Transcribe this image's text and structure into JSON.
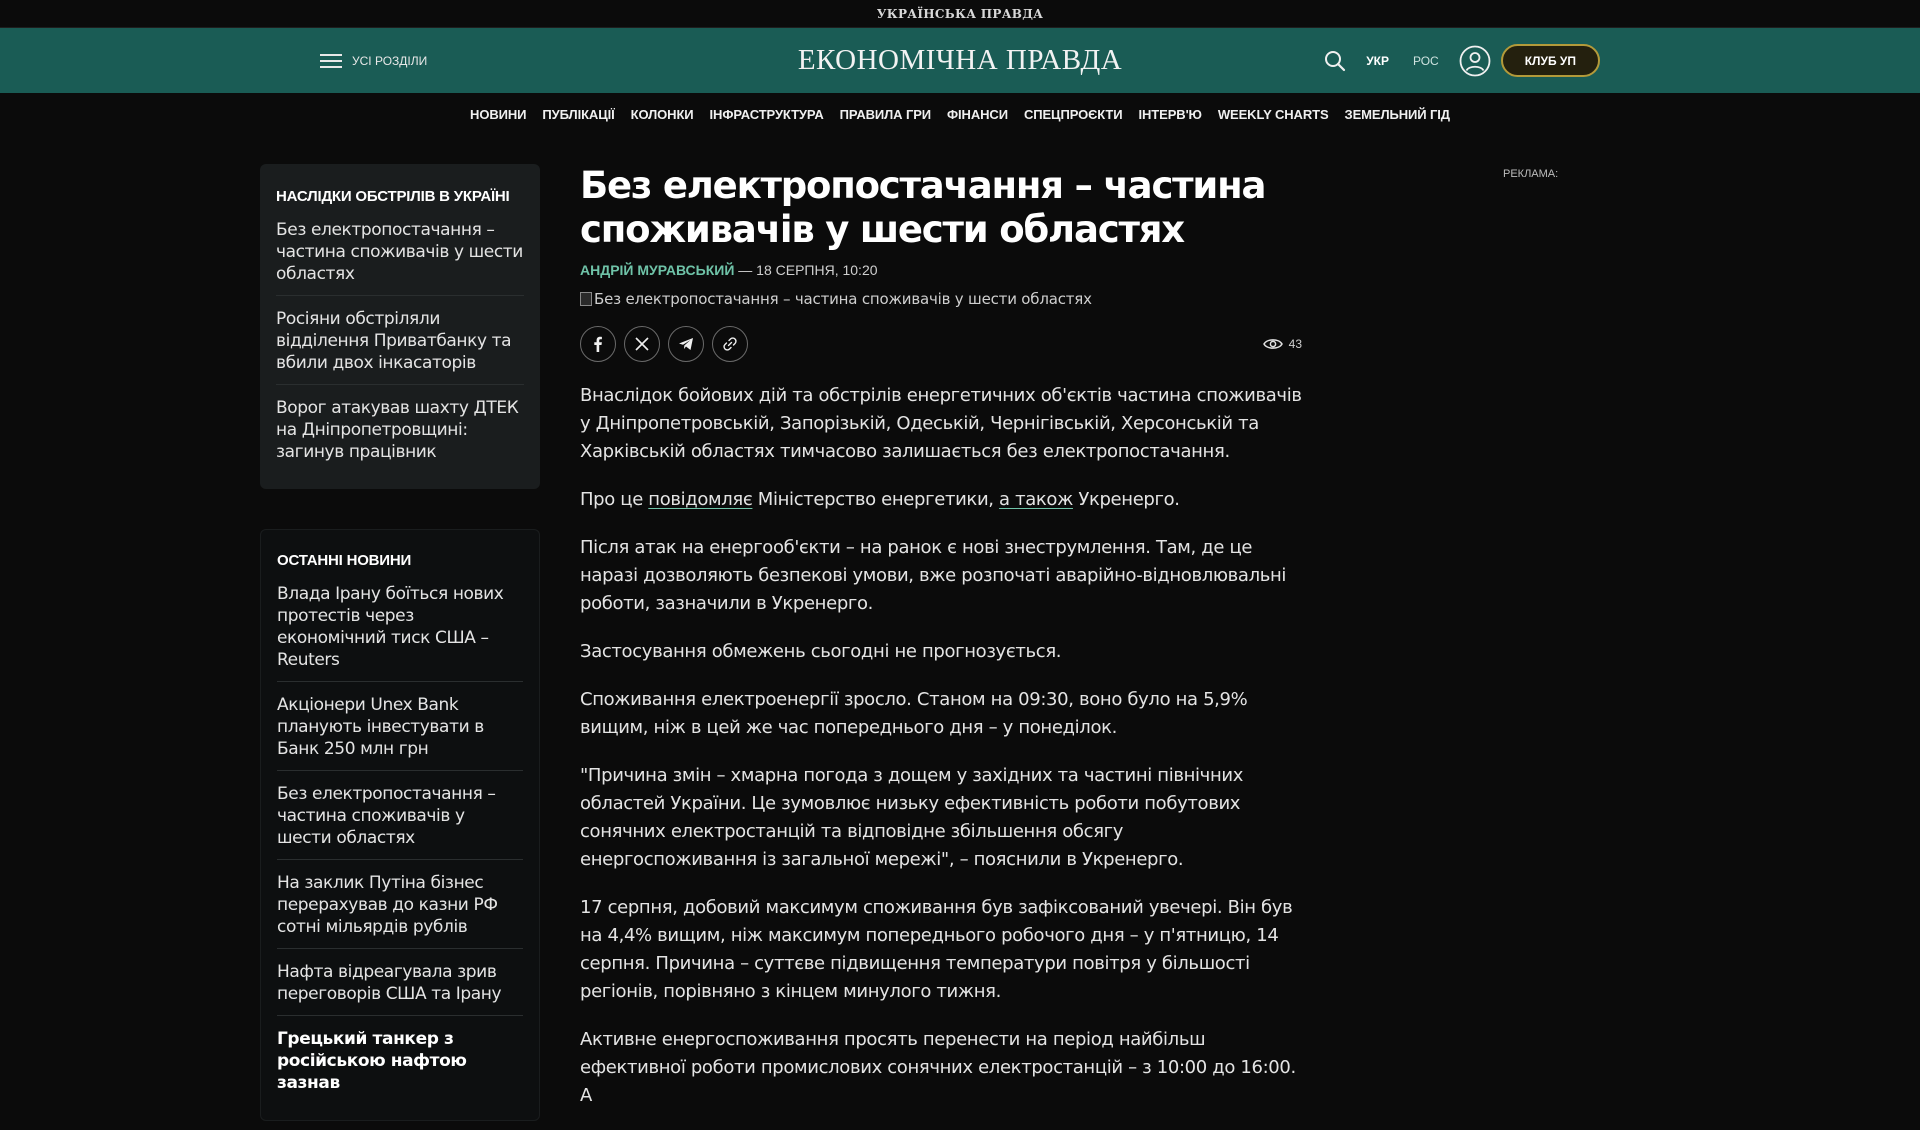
{
  "topbar": {
    "logo": "УКРАЇНСЬКА ПРАВДА"
  },
  "header": {
    "sections_label": "УСІ РОЗДІЛИ",
    "logo": "ЕКОНОМІЧНА ПРАВДА",
    "lang_ukr": "УКР",
    "lang_ros": "РОС",
    "club_label": "КЛУБ УП"
  },
  "nav": {
    "items": [
      "НОВИНИ",
      "ПУБЛІКАЦІЇ",
      "КОЛОНКИ",
      "ІНФРАСТРУКТУРА",
      "ПРАВИЛА ГРИ",
      "ФІНАНСИ",
      "СПЕЦПРОЄКТИ",
      "ІНТЕРВ'Ю",
      "WEEKLY CHARTS",
      "ЗЕМЕЛЬНИЙ ГІД"
    ]
  },
  "sidebar": {
    "consequences": {
      "title": "НАСЛІДКИ ОБСТРІЛІВ В УКРАЇНІ",
      "items": [
        "Без електропостачання – частина споживачів у шести областях",
        "Росіяни обстріляли відділення Приватбанку та вбили двох інкасаторів",
        "Ворог атакував шахту ДТЕК на Дніпропетровщині: загинув працівник"
      ]
    },
    "latest": {
      "title": "ОСТАННІ НОВИНИ",
      "items": [
        "Влада Ірану боїться нових протестів через економічний тиск США – Reuters",
        "Акціонери Unex Bank планують інвестувати в Банк 250 млн грн",
        "Без електропостачання – частина споживачів у шести областях",
        "На заклик Путіна бізнес перерахував до казни РФ сотні мільярдів рублів",
        "Нафта відреагувала зрив переговорів США та Ірану",
        "Грецький танкер з російською нафтою зазнав"
      ]
    }
  },
  "article": {
    "headline": "Без електропостачання – частина споживачів у шести областях",
    "author": "АНДРІЙ МУРАВСЬКИЙ",
    "date": " — 18 СЕРПНЯ, 10:20",
    "image_alt": "Без електропостачання – частина споживачів у шести областях",
    "views": "43",
    "p1": "Внаслідок бойових дій та обстрілів енергетичних об'єктів частина споживачів у Дніпропетровській, Запорізькій, Одеській, Чернігівській, Херсонській та Харківській областях тимчасово залишається без електропостачання.",
    "p2_a": "Про це ",
    "p2_link1": "повідомляє",
    "p2_b": " Міністерство енергетики, ",
    "p2_link2": "а також",
    "p2_c": " Укренерго.",
    "p3": "Після атак на енергооб'єкти – на ранок є нові знеструмлення. Там, де це наразі дозволяють безпекові умови, вже розпочаті аварійно-відновлювальні роботи, зазначили в Укренерго.",
    "p4": "Застосування обмежень сьогодні не прогнозується.",
    "p5": "Споживання електроенергії зросло. Станом на 09:30, воно було на 5,9% вищим, ніж в цей же час попереднього дня – у понеділок.",
    "p6": "\"Причина змін – хмарна погода з дощем у західних та частині північних областей України. Це зумовлює низьку ефективність роботи побутових сонячних електростанцій та відповідне збільшення обсягу енергоспоживання із загальної мережі\", – пояснили в Укренерго.",
    "p7": "17 серпня, добовий максимум споживання був зафіксований увечері. Він був на 4,4% вищим, ніж максимум попереднього робочого дня – у п'ятницю, 14 серпня. Причина – суттєве підвищення температури повітря у більшості регіонів, порівняно з кінцем минулого тижня.",
    "p8": "Активне енергоспоживання просять перенести на період найбільш ефективної роботи промислових сонячних електростанцій – з 10:00 до 16:00. А"
  },
  "ad": {
    "label": "РЕКЛАМА:"
  },
  "colors": {
    "header_bg": "#1a5c55",
    "accent": "#6fc3a8",
    "club_border": "#b39a3a"
  }
}
